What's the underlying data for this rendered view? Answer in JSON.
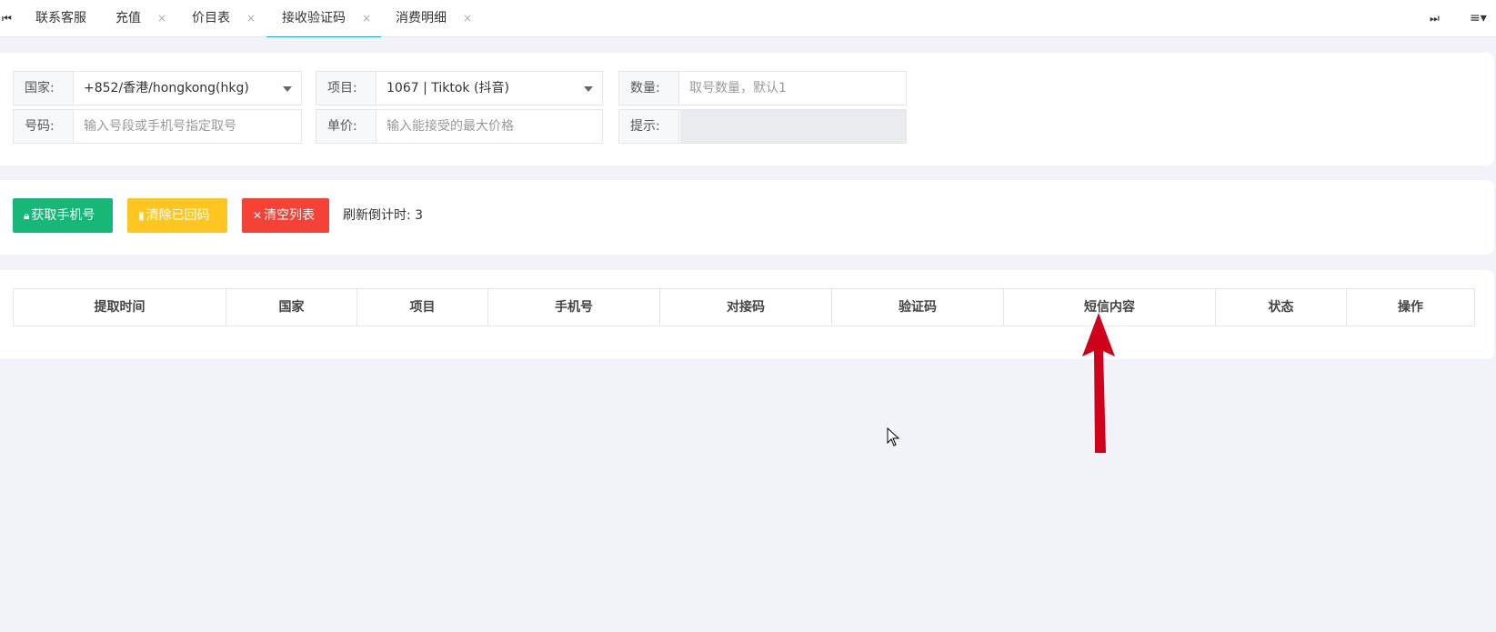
{
  "tabbar": {
    "left_nav_icon": "first-page-icon",
    "right_nav_icon": "last-page-icon",
    "menu_icon": "hamburger-menu-icon",
    "tabs": [
      {
        "label": "联系客服",
        "closable": false,
        "active": false
      },
      {
        "label": "充值",
        "closable": true,
        "active": false
      },
      {
        "label": "价目表",
        "closable": true,
        "active": false
      },
      {
        "label": "接收验证码",
        "closable": true,
        "active": true
      },
      {
        "label": "消费明细",
        "closable": true,
        "active": false
      }
    ],
    "close_glyph": "×"
  },
  "form": {
    "country": {
      "label": "国家:",
      "value": "+852/香港/hongkong(hkg)"
    },
    "project": {
      "label": "项目:",
      "value": "1067 | Tiktok (抖音)"
    },
    "quantity": {
      "label": "数量:",
      "placeholder": "取号数量，默认1"
    },
    "number": {
      "label": "号码:",
      "placeholder": "输入号段或手机号指定取号"
    },
    "price": {
      "label": "单价:",
      "placeholder": "输入能接受的最大价格"
    },
    "hint": {
      "label": "提示:",
      "value": ""
    }
  },
  "actions": {
    "get_phone": {
      "label": "获取手机号",
      "color": "#16b777"
    },
    "clear_received": {
      "label": "清除已回码",
      "color": "#ffc521"
    },
    "clear_list": {
      "label": "清空列表",
      "color": "#f44336"
    },
    "countdown_label": "刷新倒计时:",
    "countdown_value": "3"
  },
  "table": {
    "columns": [
      "提取时间",
      "国家",
      "项目",
      "手机号",
      "对接码",
      "验证码",
      "短信内容",
      "状态",
      "操作"
    ],
    "rows": []
  },
  "colors": {
    "accent": "#1e9fff",
    "annotation_arrow": "#d0021b"
  }
}
